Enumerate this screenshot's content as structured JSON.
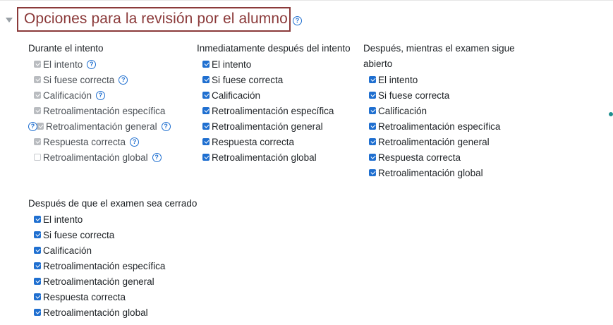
{
  "section": {
    "title": "Opciones para la revisión por el alumno",
    "help_icon": "question-circle-icon",
    "collapse_icon": "caret-down-icon"
  },
  "colors": {
    "header_text": "#8b3a3a",
    "header_border": "#8b3a3a",
    "checkbox_checked": "#1f6fd0",
    "checkbox_disabled": "#b9bcc0",
    "help_icon": "#1f6fd0"
  },
  "columns": {
    "during": {
      "heading": "Durante el intento",
      "options": [
        {
          "label": "El intento",
          "state": "disabled-checked",
          "help": true
        },
        {
          "label": "Si fuese correcta",
          "state": "disabled-checked",
          "help": true
        },
        {
          "label": "Calificación",
          "state": "disabled-checked",
          "help": true
        },
        {
          "label": "Retroalimentación específica",
          "state": "disabled-checked",
          "help": false
        },
        {
          "label": "Retroalimentación general",
          "state": "disabled-checked",
          "help": true
        },
        {
          "label": "Respuesta correcta",
          "state": "disabled-checked",
          "help": true
        },
        {
          "label": "Retroalimentación global",
          "state": "disabled-unchecked",
          "help": true
        }
      ]
    },
    "immediately": {
      "heading": "Inmediatamente después del intento",
      "options": [
        {
          "label": "El intento",
          "state": "checked"
        },
        {
          "label": "Si fuese correcta",
          "state": "checked"
        },
        {
          "label": "Calificación",
          "state": "checked"
        },
        {
          "label": "Retroalimentación específica",
          "state": "checked"
        },
        {
          "label": "Retroalimentación general",
          "state": "checked"
        },
        {
          "label": "Respuesta correcta",
          "state": "checked"
        },
        {
          "label": "Retroalimentación global",
          "state": "checked"
        }
      ]
    },
    "open": {
      "heading_line1": "Después, mientras el examen sigue",
      "heading_line2": "abierto",
      "options": [
        {
          "label": "El intento",
          "state": "checked"
        },
        {
          "label": "Si fuese correcta",
          "state": "checked"
        },
        {
          "label": "Calificación",
          "state": "checked"
        },
        {
          "label": "Retroalimentación específica",
          "state": "checked"
        },
        {
          "label": "Retroalimentación general",
          "state": "checked"
        },
        {
          "label": "Respuesta correcta",
          "state": "checked"
        },
        {
          "label": "Retroalimentación global",
          "state": "checked"
        }
      ]
    },
    "closed": {
      "heading": "Después de que el examen sea cerrado",
      "options": [
        {
          "label": "El intento",
          "state": "checked"
        },
        {
          "label": "Si fuese correcta",
          "state": "checked"
        },
        {
          "label": "Calificación",
          "state": "checked"
        },
        {
          "label": "Retroalimentación específica",
          "state": "checked"
        },
        {
          "label": "Retroalimentación general",
          "state": "checked"
        },
        {
          "label": "Respuesta correcta",
          "state": "checked"
        },
        {
          "label": "Retroalimentación global",
          "state": "checked"
        }
      ]
    }
  },
  "help_glyph": "?"
}
